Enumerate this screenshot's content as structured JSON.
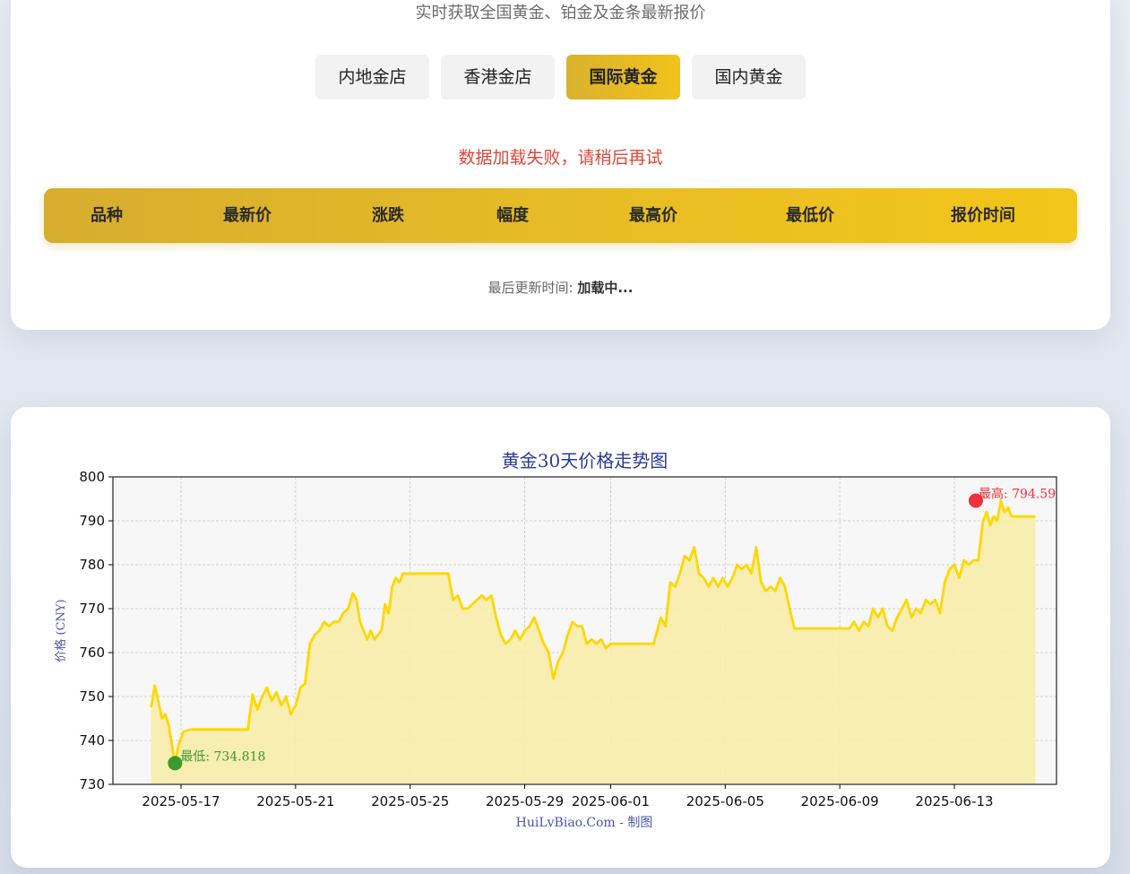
{
  "header": {
    "subtitle": "实时获取全国黄金、铂金及金条最新报价"
  },
  "tabs": [
    {
      "label": "内地金店",
      "active": false
    },
    {
      "label": "香港金店",
      "active": false
    },
    {
      "label": "国际黄金",
      "active": true
    },
    {
      "label": "国内黄金",
      "active": false
    }
  ],
  "status": {
    "error": "数据加载失败，请稍后再试"
  },
  "table": {
    "columns": [
      "品种",
      "最新价",
      "涨跌",
      "幅度",
      "最高价",
      "最低价",
      "报价时间"
    ]
  },
  "update": {
    "label": "最后更新时间:",
    "value": "加载中..."
  },
  "colors": {
    "accent_start": "#d6ad2f",
    "accent_end": "#f3c61a",
    "error": "#e0453a",
    "line": "#ffd700",
    "fill": "#f7eca9",
    "min_marker": "#3a9a2a",
    "max_marker": "#f0303a"
  },
  "chart_data": {
    "type": "area",
    "title": "黄金30天价格走势图",
    "ylabel": "价格 (CNY)",
    "xlabel": "",
    "watermark": "HuiLvBiao.Com - 制图",
    "ylim": [
      730,
      800
    ],
    "yticks": [
      730,
      740,
      750,
      760,
      770,
      780,
      790,
      800
    ],
    "xlim": [
      "2025-05-15",
      "2025-06-15"
    ],
    "xticks": [
      "2025-05-17",
      "2025-05-21",
      "2025-05-25",
      "2025-05-29",
      "2025-06-01",
      "2025-06-05",
      "2025-06-09",
      "2025-06-13"
    ],
    "grid": true,
    "min": {
      "date": "2025-05-16 19:00",
      "value": 734.818,
      "label": "最低: 734.818"
    },
    "max": {
      "date": "2025-06-13 18:00",
      "value": 794.59,
      "label": "最高: 794.59"
    },
    "series": [
      {
        "points": [
          [
            "2025-05-15 23:00",
            747.5
          ],
          [
            "2025-05-16 02:00",
            752.5
          ],
          [
            "2025-05-16 05:00",
            749
          ],
          [
            "2025-05-16 08:00",
            745
          ],
          [
            "2025-05-16 11:00",
            746
          ],
          [
            "2025-05-16 14:00",
            743
          ],
          [
            "2025-05-16 17:00",
            738
          ],
          [
            "2025-05-16 19:00",
            734.8
          ],
          [
            "2025-05-16 22:00",
            739
          ],
          [
            "2025-05-17 02:00",
            742
          ],
          [
            "2025-05-17 08:00",
            742.5
          ],
          [
            "2025-05-18 00:00",
            742.5
          ],
          [
            "2025-05-19 00:00",
            742.5
          ],
          [
            "2025-05-19 08:00",
            742.5
          ],
          [
            "2025-05-19 12:00",
            750.5
          ],
          [
            "2025-05-19 16:00",
            747
          ],
          [
            "2025-05-19 20:00",
            750
          ],
          [
            "2025-05-20 00:00",
            752
          ],
          [
            "2025-05-20 04:00",
            749
          ],
          [
            "2025-05-20 08:00",
            751
          ],
          [
            "2025-05-20 12:00",
            748
          ],
          [
            "2025-05-20 16:00",
            750
          ],
          [
            "2025-05-20 20:00",
            746
          ],
          [
            "2025-05-21 00:00",
            748
          ],
          [
            "2025-05-21 04:00",
            752
          ],
          [
            "2025-05-21 08:00",
            753
          ],
          [
            "2025-05-21 12:00",
            762
          ],
          [
            "2025-05-21 16:00",
            764
          ],
          [
            "2025-05-21 20:00",
            765
          ],
          [
            "2025-05-22 00:00",
            767
          ],
          [
            "2025-05-22 04:00",
            766
          ],
          [
            "2025-05-22 08:00",
            767
          ],
          [
            "2025-05-22 12:00",
            767
          ],
          [
            "2025-05-22 16:00",
            769
          ],
          [
            "2025-05-22 20:00",
            770
          ],
          [
            "2025-05-23 00:00",
            773.5
          ],
          [
            "2025-05-23 03:00",
            772
          ],
          [
            "2025-05-23 06:00",
            767
          ],
          [
            "2025-05-23 09:00",
            765
          ],
          [
            "2025-05-23 12:00",
            763
          ],
          [
            "2025-05-23 15:00",
            765
          ],
          [
            "2025-05-23 18:00",
            763
          ],
          [
            "2025-05-23 21:00",
            764
          ],
          [
            "2025-05-24 00:00",
            765
          ],
          [
            "2025-05-24 03:00",
            771
          ],
          [
            "2025-05-24 06:00",
            769
          ],
          [
            "2025-05-24 09:00",
            775
          ],
          [
            "2025-05-24 12:00",
            777
          ],
          [
            "2025-05-24 15:00",
            776
          ],
          [
            "2025-05-24 18:00",
            778
          ],
          [
            "2025-05-25 00:00",
            778
          ],
          [
            "2025-05-26 00:00",
            778
          ],
          [
            "2025-05-26 08:00",
            778
          ],
          [
            "2025-05-26 12:00",
            772
          ],
          [
            "2025-05-26 16:00",
            773
          ],
          [
            "2025-05-26 20:00",
            770
          ],
          [
            "2025-05-27 00:00",
            770
          ],
          [
            "2025-05-27 04:00",
            771
          ],
          [
            "2025-05-27 08:00",
            772
          ],
          [
            "2025-05-27 12:00",
            773
          ],
          [
            "2025-05-27 16:00",
            772
          ],
          [
            "2025-05-27 20:00",
            773
          ],
          [
            "2025-05-28 00:00",
            768
          ],
          [
            "2025-05-28 04:00",
            764
          ],
          [
            "2025-05-28 08:00",
            762
          ],
          [
            "2025-05-28 12:00",
            763
          ],
          [
            "2025-05-28 16:00",
            765
          ],
          [
            "2025-05-28 20:00",
            763
          ],
          [
            "2025-05-29 00:00",
            765
          ],
          [
            "2025-05-29 04:00",
            766
          ],
          [
            "2025-05-29 08:00",
            768
          ],
          [
            "2025-05-29 12:00",
            765
          ],
          [
            "2025-05-29 16:00",
            762
          ],
          [
            "2025-05-29 20:00",
            760
          ],
          [
            "2025-05-30 00:00",
            754
          ],
          [
            "2025-05-30 04:00",
            758
          ],
          [
            "2025-05-30 08:00",
            760
          ],
          [
            "2025-05-30 12:00",
            764
          ],
          [
            "2025-05-30 16:00",
            767
          ],
          [
            "2025-05-30 20:00",
            766
          ],
          [
            "2025-05-31 00:00",
            766
          ],
          [
            "2025-05-31 04:00",
            762
          ],
          [
            "2025-05-31 08:00",
            763
          ],
          [
            "2025-05-31 12:00",
            762
          ],
          [
            "2025-05-31 16:00",
            763
          ],
          [
            "2025-05-31 20:00",
            761
          ],
          [
            "2025-06-01 00:00",
            762
          ],
          [
            "2025-06-01 12:00",
            762
          ],
          [
            "2025-06-02 00:00",
            762
          ],
          [
            "2025-06-02 12:00",
            762
          ],
          [
            "2025-06-02 18:00",
            768
          ],
          [
            "2025-06-02 22:00",
            766
          ],
          [
            "2025-06-03 02:00",
            776
          ],
          [
            "2025-06-03 06:00",
            775
          ],
          [
            "2025-06-03 10:00",
            778
          ],
          [
            "2025-06-03 14:00",
            782
          ],
          [
            "2025-06-03 18:00",
            781
          ],
          [
            "2025-06-03 22:00",
            784
          ],
          [
            "2025-06-04 02:00",
            778
          ],
          [
            "2025-06-04 06:00",
            777
          ],
          [
            "2025-06-04 10:00",
            775
          ],
          [
            "2025-06-04 14:00",
            777
          ],
          [
            "2025-06-04 18:00",
            775
          ],
          [
            "2025-06-04 22:00",
            777
          ],
          [
            "2025-06-05 02:00",
            775
          ],
          [
            "2025-06-05 06:00",
            777
          ],
          [
            "2025-06-05 10:00",
            780
          ],
          [
            "2025-06-05 14:00",
            779
          ],
          [
            "2025-06-05 18:00",
            780
          ],
          [
            "2025-06-05 22:00",
            778
          ],
          [
            "2025-06-06 02:00",
            784
          ],
          [
            "2025-06-06 06:00",
            776
          ],
          [
            "2025-06-06 10:00",
            774
          ],
          [
            "2025-06-06 14:00",
            775
          ],
          [
            "2025-06-06 18:00",
            774
          ],
          [
            "2025-06-06 22:00",
            777
          ],
          [
            "2025-06-07 02:00",
            775
          ],
          [
            "2025-06-07 06:00",
            770
          ],
          [
            "2025-06-07 10:00",
            765.5
          ],
          [
            "2025-06-08 00:00",
            765.5
          ],
          [
            "2025-06-09 00:00",
            765.5
          ],
          [
            "2025-06-09 08:00",
            765.5
          ],
          [
            "2025-06-09 12:00",
            767
          ],
          [
            "2025-06-09 16:00",
            765
          ],
          [
            "2025-06-09 20:00",
            767
          ],
          [
            "2025-06-10 00:00",
            766
          ],
          [
            "2025-06-10 04:00",
            770
          ],
          [
            "2025-06-10 08:00",
            768
          ],
          [
            "2025-06-10 12:00",
            770
          ],
          [
            "2025-06-10 16:00",
            766
          ],
          [
            "2025-06-10 20:00",
            765
          ],
          [
            "2025-06-11 00:00",
            768
          ],
          [
            "2025-06-11 04:00",
            770
          ],
          [
            "2025-06-11 08:00",
            772
          ],
          [
            "2025-06-11 12:00",
            768
          ],
          [
            "2025-06-11 16:00",
            770
          ],
          [
            "2025-06-11 20:00",
            769
          ],
          [
            "2025-06-12 00:00",
            772
          ],
          [
            "2025-06-12 04:00",
            771
          ],
          [
            "2025-06-12 08:00",
            772
          ],
          [
            "2025-06-12 12:00",
            769
          ],
          [
            "2025-06-12 16:00",
            776
          ],
          [
            "2025-06-12 20:00",
            779
          ],
          [
            "2025-06-13 00:00",
            780
          ],
          [
            "2025-06-13 04:00",
            777
          ],
          [
            "2025-06-13 08:00",
            781
          ],
          [
            "2025-06-13 12:00",
            780
          ],
          [
            "2025-06-13 16:00",
            781
          ],
          [
            "2025-06-13 20:00",
            781
          ],
          [
            "2025-06-14 00:00",
            790
          ],
          [
            "2025-06-14 03:00",
            792
          ],
          [
            "2025-06-14 06:00",
            789
          ],
          [
            "2025-06-14 09:00",
            791
          ],
          [
            "2025-06-14 12:00",
            790
          ],
          [
            "2025-06-14 15:00",
            794.59
          ],
          [
            "2025-06-14 18:00",
            792
          ],
          [
            "2025-06-14 21:00",
            793
          ],
          [
            "2025-06-15 00:00",
            791
          ],
          [
            "2025-06-15 12:00",
            791
          ],
          [
            "2025-06-15 20:00",
            791
          ]
        ]
      }
    ]
  }
}
